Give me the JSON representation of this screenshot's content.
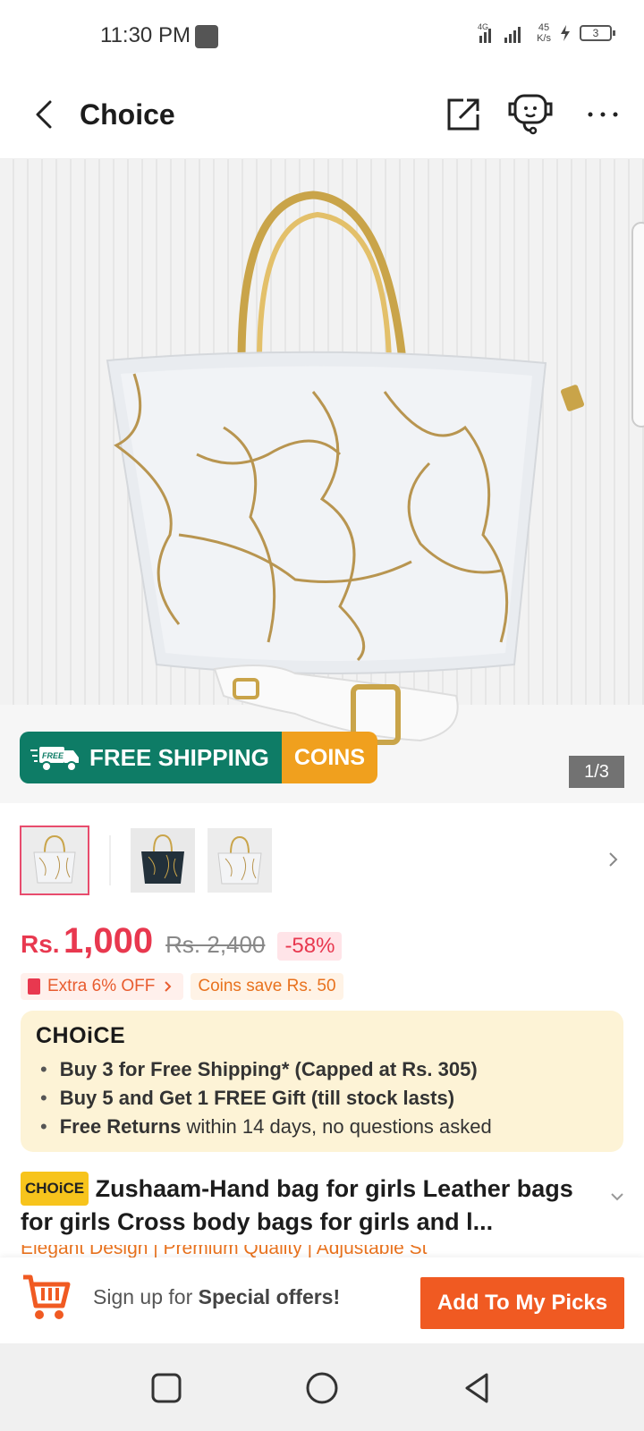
{
  "status_bar": {
    "time": "11:30 PM",
    "network_label": "4G",
    "speed_value": "45",
    "speed_unit": "K/s",
    "battery": "3"
  },
  "app_bar": {
    "title": "Choice",
    "icons": [
      "back-arrow-icon",
      "share-icon",
      "chat-bot-icon",
      "more-icon"
    ]
  },
  "hero": {
    "image_counter": "1/3",
    "banner": {
      "free_tag": "FREE",
      "shipping_text": "FREE SHIPPING",
      "coins_text": "COINS",
      "colors": {
        "shipping": "#0e7c66",
        "coins": "#f0a01e"
      }
    }
  },
  "price": {
    "currency": "Rs.",
    "current": "1,000",
    "original": "Rs. 2,400",
    "discount": "-58%",
    "accent_color": "#e8384f"
  },
  "promos": {
    "extra_off": "Extra 6% OFF",
    "coins_save": "Coins save Rs. 50"
  },
  "choice_card": {
    "logo": "CHOiCE",
    "benefits": [
      {
        "bold": "Buy 3 for  Free Shipping* (Capped at Rs. 305)",
        "rest": ""
      },
      {
        "bold": "Buy 5 and Get 1 FREE Gift (till stock lasts)",
        "rest": ""
      },
      {
        "bold": "Free Returns",
        "rest": " within 14 days, no questions asked"
      }
    ]
  },
  "product": {
    "badge": "CHOiCE",
    "title": "Zushaam-Hand bag for girls Leather bags for girls Cross body bags for girls and l...",
    "features": "Elegant Design  |  Premium Quality  |  Adjustable St"
  },
  "action_bar": {
    "signup_prefix": "Sign up for ",
    "signup_bold": "Special offers!",
    "picks_button": "Add To My Picks",
    "button_color": "#f05a22"
  },
  "nav": {
    "icons": [
      "recents-icon",
      "home-icon",
      "back-icon"
    ]
  }
}
